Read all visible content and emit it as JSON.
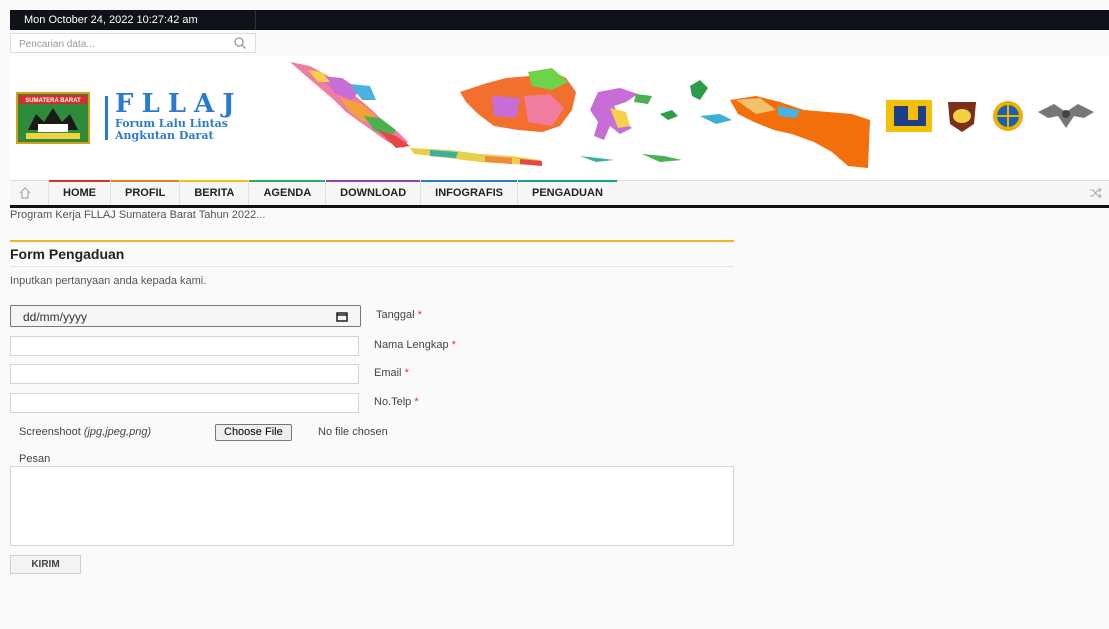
{
  "topbar": {
    "datetime": "Mon October 24, 2022 10:27:42 am"
  },
  "search": {
    "placeholder": "Pencarian data..."
  },
  "header": {
    "shield_text": "SUMATERA BARAT",
    "logo_title": "FLLAJ",
    "logo_subtitle_1": "Forum Lalu Lintas",
    "logo_subtitle_2": "Angkutan Darat",
    "accent_color": "#2a7bd0"
  },
  "nav": {
    "items": [
      {
        "label": "HOME"
      },
      {
        "label": "PROFIL"
      },
      {
        "label": "BERITA"
      },
      {
        "label": "AGENDA"
      },
      {
        "label": "DOWNLOAD"
      },
      {
        "label": "INFOGRAFIS"
      },
      {
        "label": "PENGADUAN"
      }
    ]
  },
  "ticker": {
    "text": "Program Kerja FLLAJ Sumatera Barat Tahun 2022..."
  },
  "form": {
    "title": "Form Pengaduan",
    "intro": "Inputkan pertanyaan anda kepada kami.",
    "date": {
      "placeholder": "dd/mm/yyyy",
      "label": "Tanggal",
      "required": "*"
    },
    "name": {
      "label": "Nama Lengkap",
      "required": "*",
      "value": ""
    },
    "email": {
      "label": "Email",
      "required": "*",
      "value": ""
    },
    "phone": {
      "label": "No.Telp",
      "required": "*",
      "value": ""
    },
    "screenshot": {
      "label": "Screenshoot",
      "formats": "(jpg,jpeg,png)",
      "button": "Choose File",
      "status": "No file chosen"
    },
    "message": {
      "label": "Pesan",
      "value": ""
    },
    "submit": "KIRIM"
  }
}
